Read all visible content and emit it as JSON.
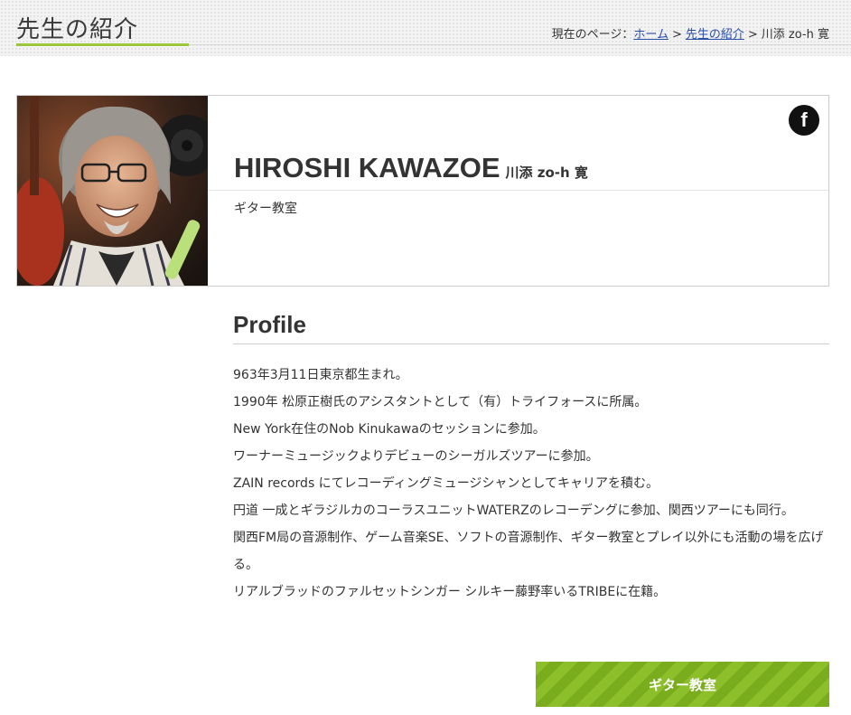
{
  "header": {
    "title": "先生の紹介",
    "breadcrumb": {
      "prefix": "現在のページ：",
      "home": "ホーム",
      "separator": ">",
      "section": "先生の紹介",
      "current": "川添 zo-h 寛"
    }
  },
  "teacher": {
    "name_en": "HIROSHI KAWAZOE",
    "name_jp": "川添 zo-h 寛",
    "course": "ギター教室",
    "social_icon": "facebook-icon",
    "social_glyph": "f"
  },
  "profile": {
    "heading": "Profile",
    "lines": [
      "963年3月11日東京都生まれ。",
      "1990年 松原正樹氏のアシスタントとして（有）トライフォースに所属。",
      "New York在住のNob Kinukawaのセッションに参加。",
      "ワーナーミュージックよりデビューのシーガルズツアーに参加。",
      "ZAIN records にてレコーディングミュージシャンとしてキャリアを積む。",
      "円道 一成とギラジルカのコーラスユニットWATERZのレコーデングに参加、関西ツアーにも同行。",
      "関西FM局の音源制作、ゲーム音楽SE、ソフトの音源制作、ギター教室とプレイ以外にも活動の場を広げる。",
      "リアルブラッドのファルセットシンガー シルキー藤野率いるTRIBEに在籍。"
    ]
  },
  "cta": {
    "label": "ギター教室"
  },
  "colors": {
    "accent_green": "#9bc63c",
    "button_green": "#8cbf2a",
    "link_blue": "#2a4fa8"
  }
}
